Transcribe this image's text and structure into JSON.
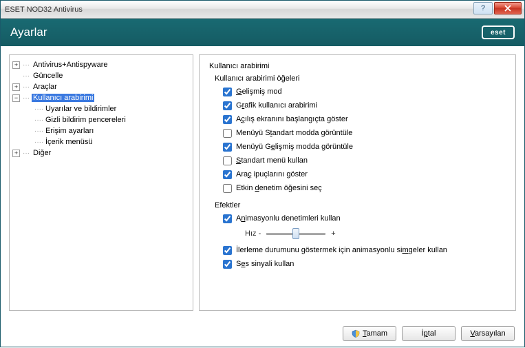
{
  "window": {
    "title": "ESET NOD32 Antivirus",
    "logo": "eset"
  },
  "header": {
    "title": "Ayarlar"
  },
  "tree": {
    "items": [
      {
        "label": "Antivirus+Antispyware",
        "exp": "plus"
      },
      {
        "label": "Güncelle",
        "exp": "none"
      },
      {
        "label": "Araçlar",
        "exp": "plus"
      },
      {
        "label": "Kullanıcı arabirimi",
        "exp": "minus",
        "selected": true,
        "children": [
          {
            "label": "Uyarılar ve bildirimler"
          },
          {
            "label": "Gizli bildirim pencereleri"
          },
          {
            "label": "Erişim ayarları"
          },
          {
            "label": "İçerik menüsü"
          }
        ]
      },
      {
        "label": "Diğer",
        "exp": "plus"
      }
    ]
  },
  "content": {
    "title": "Kullanıcı arabirimi",
    "group1": {
      "title": "Kullanıcı arabirimi öğeleri",
      "items": [
        {
          "label_pre": "",
          "u": "G",
          "label_post": "elişmiş mod",
          "checked": true
        },
        {
          "label_pre": "G",
          "u": "r",
          "label_post": "afik kullanıcı arabirimi",
          "checked": true
        },
        {
          "label_pre": "A",
          "u": "ç",
          "label_post": "ılış ekranını başlangıçta göster",
          "checked": true
        },
        {
          "label_pre": "Menüyü S",
          "u": "t",
          "label_post": "andart modda görüntüle",
          "checked": false
        },
        {
          "label_pre": "Menüyü G",
          "u": "e",
          "label_post": "lişmiş modda görüntüle",
          "checked": true
        },
        {
          "label_pre": "",
          "u": "S",
          "label_post": "tandart menü kullan",
          "checked": false
        },
        {
          "label_pre": "Ara",
          "u": "ç",
          "label_post": " ipuçlarını göster",
          "checked": true
        },
        {
          "label_pre": "Etkin ",
          "u": "d",
          "label_post": "enetim öğesini seç",
          "checked": false
        }
      ]
    },
    "group2": {
      "title": "Efektler",
      "items": [
        {
          "label_pre": "A",
          "u": "n",
          "label_post": "imasyonlu denetimleri kullan",
          "checked": true
        }
      ],
      "slider": {
        "label": "Hız",
        "minus": "-",
        "plus": "+"
      },
      "items2": [
        {
          "label_pre": "İlerleme durumunu göstermek için animasyonlu si",
          "u": "m",
          "label_post": "geler kullan",
          "checked": true
        },
        {
          "label_pre": "S",
          "u": "e",
          "label_post": "s sinyali kullan",
          "checked": true
        }
      ]
    }
  },
  "footer": {
    "ok_u": "T",
    "ok_post": "amam",
    "cancel_pre": "İ",
    "cancel_u": "p",
    "cancel_post": "tal",
    "default_u": "V",
    "default_post": "arsayılan"
  }
}
